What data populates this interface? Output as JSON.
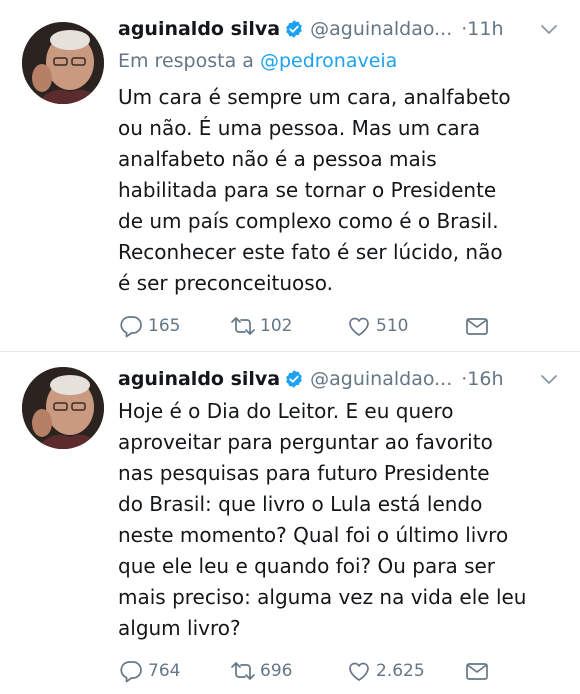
{
  "tweets": [
    {
      "author_name": "aguinaldo silva",
      "handle": "@aguinaldao...",
      "time_separator": "·",
      "time": "11h",
      "reply_prefix": "Em resposta a",
      "reply_to": "@pedronaveia",
      "text": "Um cara é sempre um cara, analfabeto\nou não. É uma pessoa. Mas um cara\nanalfabeto não é a pessoa mais\nhabilitada para se tornar o Presidente\nde um país complexo como é o Brasil.\nReconhecer este fato é ser lúcido, não\né ser preconceituoso.",
      "replies": "165",
      "retweets": "102",
      "likes": "510"
    },
    {
      "author_name": "aguinaldo silva",
      "handle": "@aguinaldao...",
      "time_separator": "·",
      "time": "16h",
      "text": "Hoje é o Dia do Leitor. E eu quero\naproveitar para perguntar ao favorito\nnas pesquisas para futuro Presidente\ndo Brasil: que livro o Lula está lendo\nneste momento? Qual foi o último livro\nque ele leu e quando foi? Ou para ser\nmais preciso: alguma vez na vida ele leu\nalgum livro?",
      "replies": "764",
      "retweets": "696",
      "likes": "2.625"
    }
  ],
  "colors": {
    "text": "#14171a",
    "muted": "#657786",
    "link": "#1da1f2",
    "verified": "#1da1f2",
    "divider": "#e1e8ed"
  },
  "icons": [
    "verified-badge-icon",
    "chevron-down-icon",
    "reply-icon",
    "retweet-icon",
    "like-icon",
    "direct-message-icon"
  ]
}
